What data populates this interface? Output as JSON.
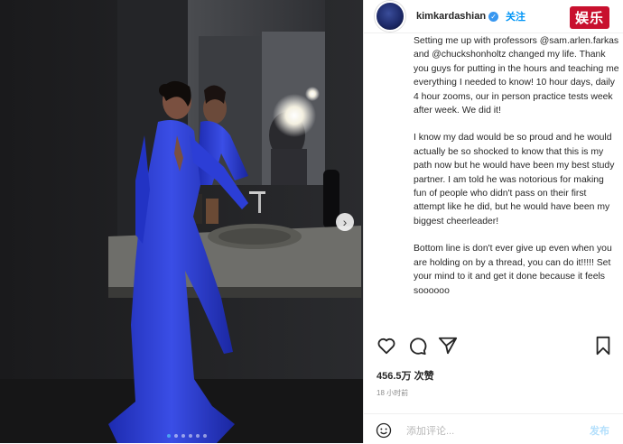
{
  "post": {
    "username": "kimkardashian",
    "follow_label": "关注",
    "watermark": "娱乐",
    "caption_paragraphs": [
      "Setting me up with professors @sam.arlen.farkas and @chuckshonholtz changed my life. Thank you guys for putting in the hours and teaching me everything I needed to know! 10 hour days, daily 4 hour zooms, our in person practice tests week after week. We did it!",
      "I know my dad would be so proud and he would actually be so shocked to know that this is my path now but he would have been my best study partner. I am told he was notorious for making fun of people who didn't pass on their first attempt like he did, but he would have been my biggest cheerleader!",
      "Bottom line is don't ever give up even when you are holding on by a thread, you can do it!!!!! Set your mind to it and get it done because it feels soooooo"
    ],
    "likes": "456.5万 次赞",
    "time": "18 小时前",
    "comment_placeholder": "添加评论...",
    "post_label": "发布"
  },
  "carousel": {
    "count": 6,
    "active_index": 0
  },
  "icons": {
    "verified": "verified-badge-icon",
    "like": "heart-icon",
    "comment": "comment-icon",
    "share": "send-icon",
    "save": "bookmark-icon",
    "emoji": "emoji-icon",
    "next": "chevron-right-icon"
  },
  "colors": {
    "link": "#0095f6",
    "dress": "#2a3fd0",
    "badge": "#c8102e"
  }
}
